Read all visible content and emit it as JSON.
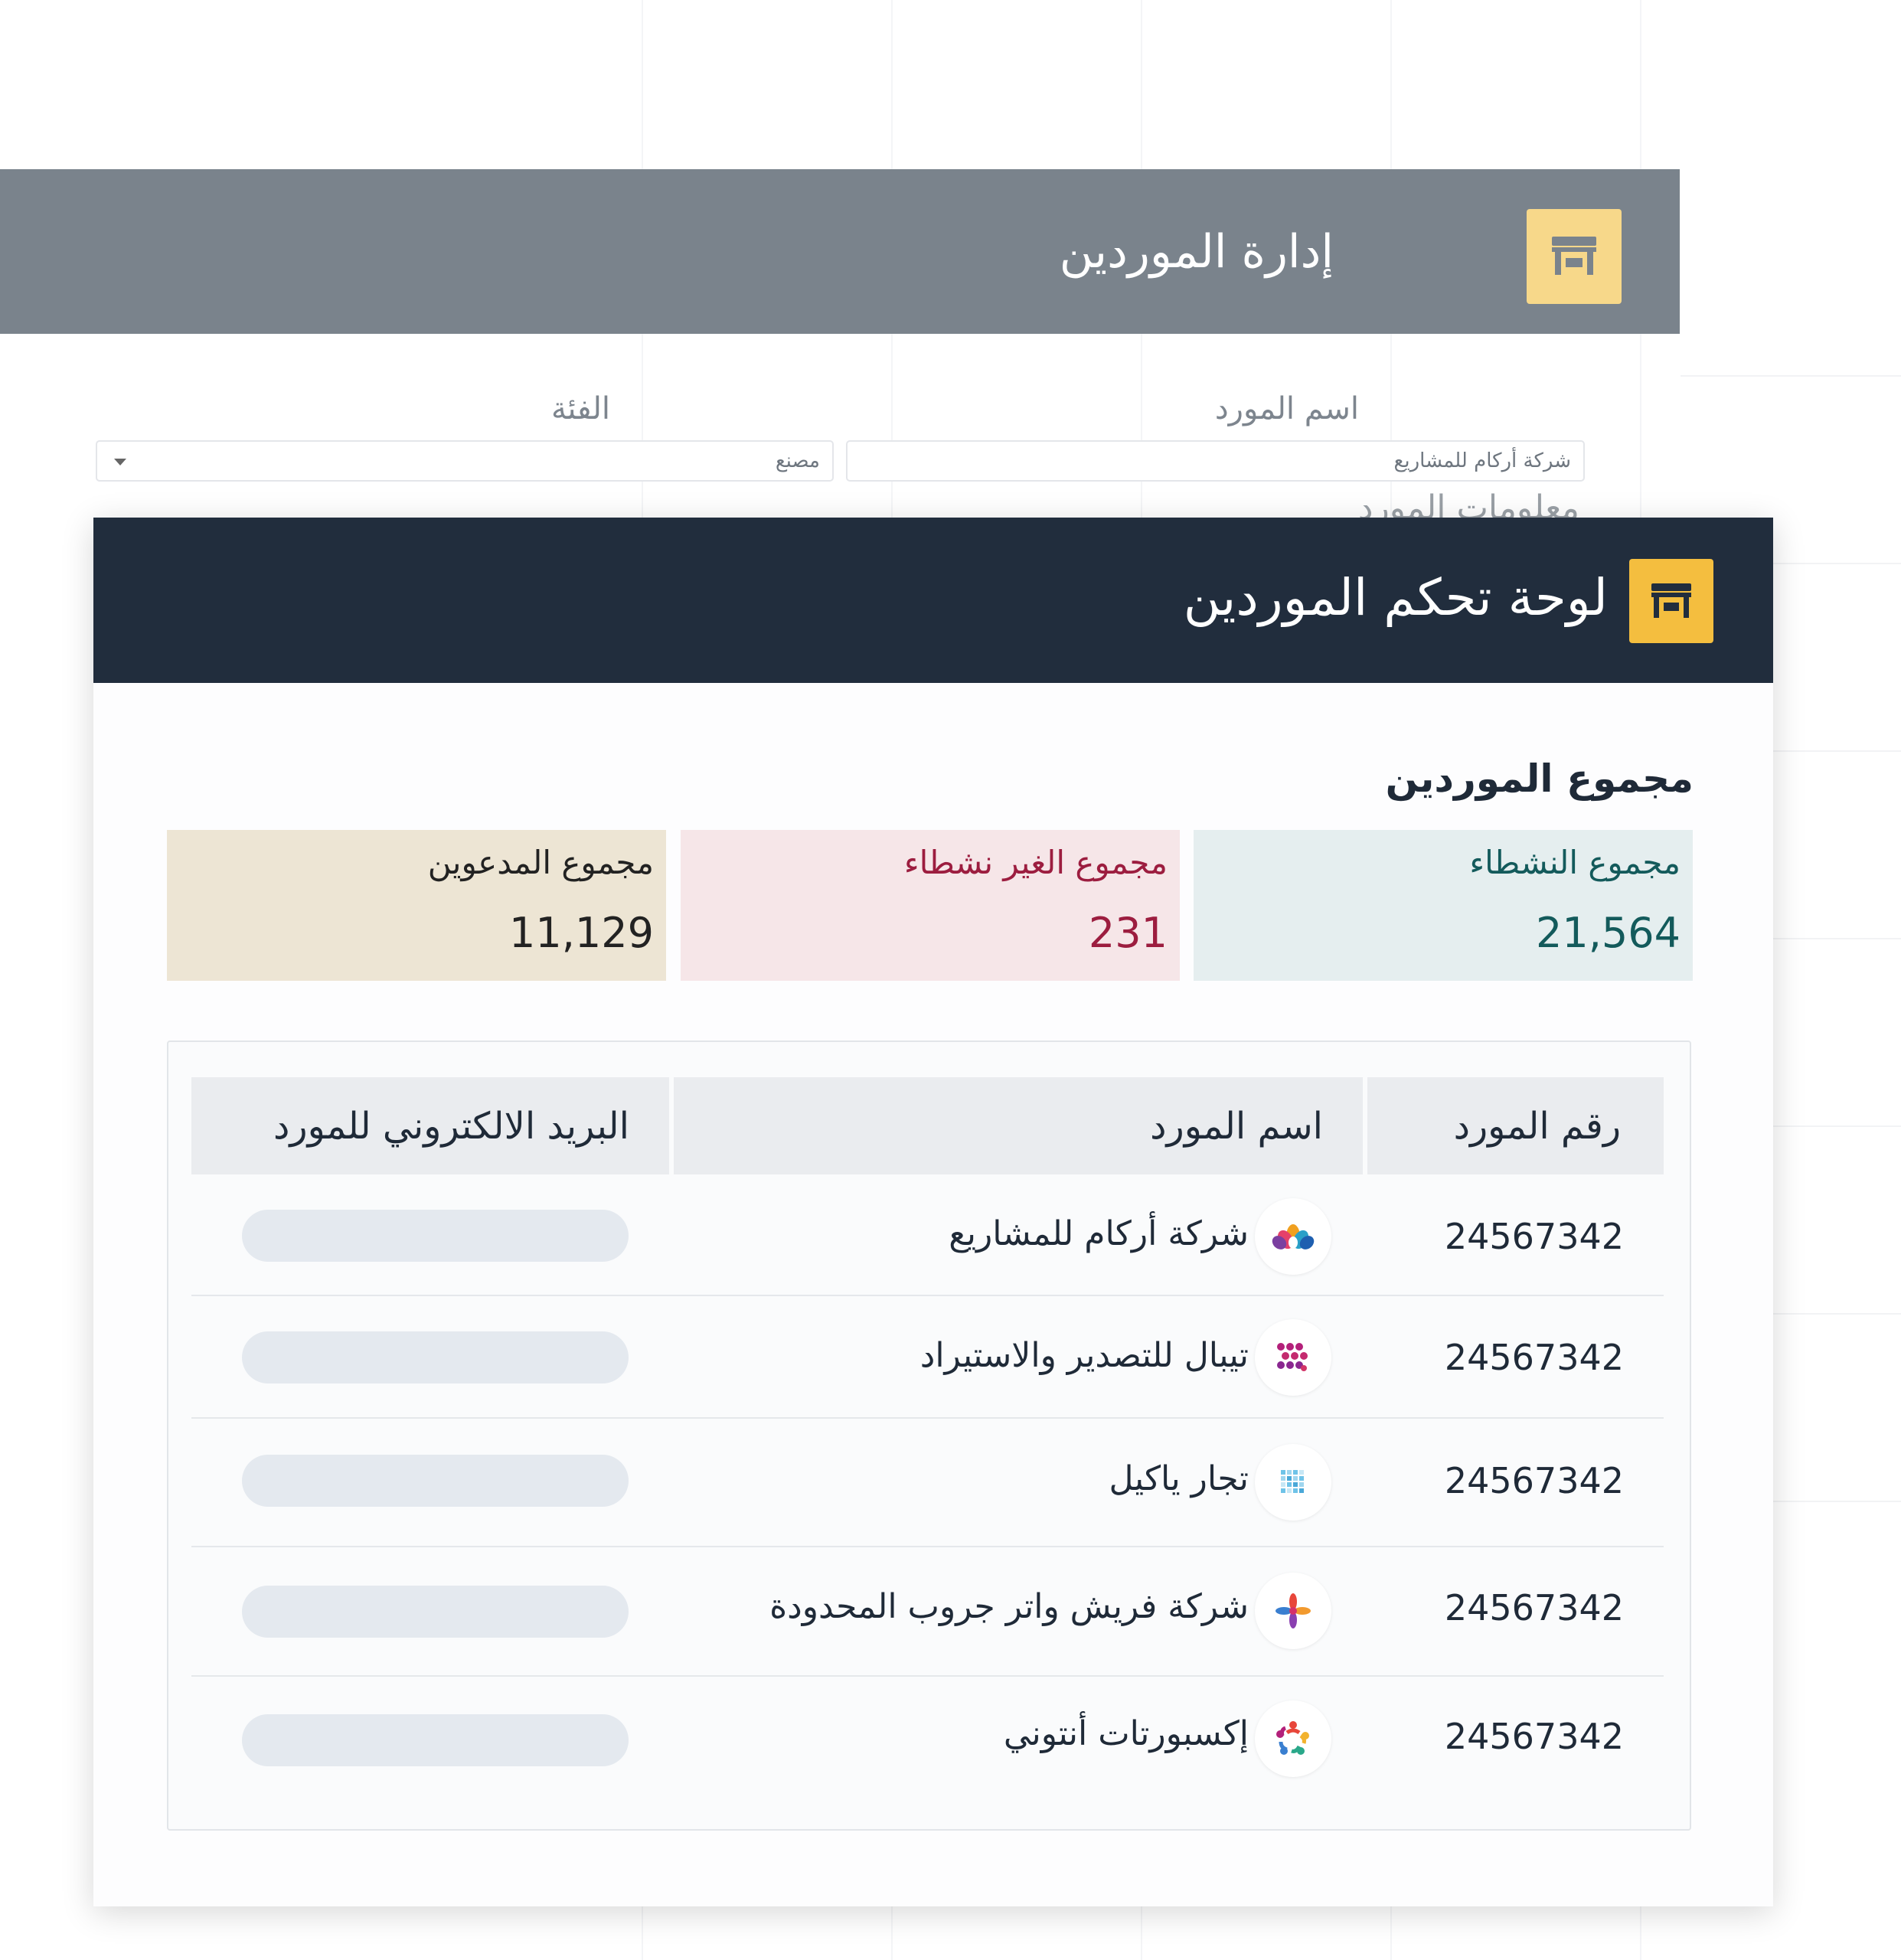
{
  "back_window": {
    "title": "إدارة الموردين",
    "icon": "store-icon",
    "form": {
      "vendor_name_label": "اسم المورد",
      "vendor_name_value": "شركة أركام للمشاريع",
      "category_label": "الفئة",
      "category_value": "مصنع",
      "section_label_partial": "معلومات المورد"
    }
  },
  "dashboard": {
    "title": "لوحة تحكم الموردين",
    "icon": "store-icon",
    "section_title": "مجموع الموردين",
    "stats": {
      "active": {
        "label": "مجموع النشطاء",
        "value": "21,564",
        "color": "#135a5b",
        "bg": "#e5eeef"
      },
      "inactive": {
        "label": "مجموع الغير نشطاء",
        "value": "231",
        "color": "#9c1d3f",
        "bg": "#f6e6e8"
      },
      "invited": {
        "label": "مجموع المدعوين",
        "value": "11,129",
        "color": "#222222",
        "bg": "#ede5d4"
      }
    },
    "table": {
      "headers": {
        "number": "رقم المورد",
        "name": "اسم المورد",
        "email": "البريد الالكتروني للمورد"
      },
      "rows": [
        {
          "number": "24567342",
          "name": "شركة أركام للمشاريع",
          "logo": "lotus-logo-icon"
        },
        {
          "number": "24567342",
          "name": "تيبال للتصدير والاستيراد",
          "logo": "dots-grid-logo-icon"
        },
        {
          "number": "24567342",
          "name": "تجار ياكيل",
          "logo": "pixel-square-logo-icon"
        },
        {
          "number": "24567342",
          "name": "شركة فريش واتر جروب المحدودة",
          "logo": "pinwheel-logo-icon"
        },
        {
          "number": "24567342",
          "name": "إكسبورتات أنتوني",
          "logo": "ring-people-logo-icon"
        }
      ]
    }
  },
  "colors": {
    "back_header": "#7a838c",
    "back_icon_bg": "#f7d88a",
    "front_header": "#212d3d",
    "front_icon_bg": "#f4be3f"
  }
}
